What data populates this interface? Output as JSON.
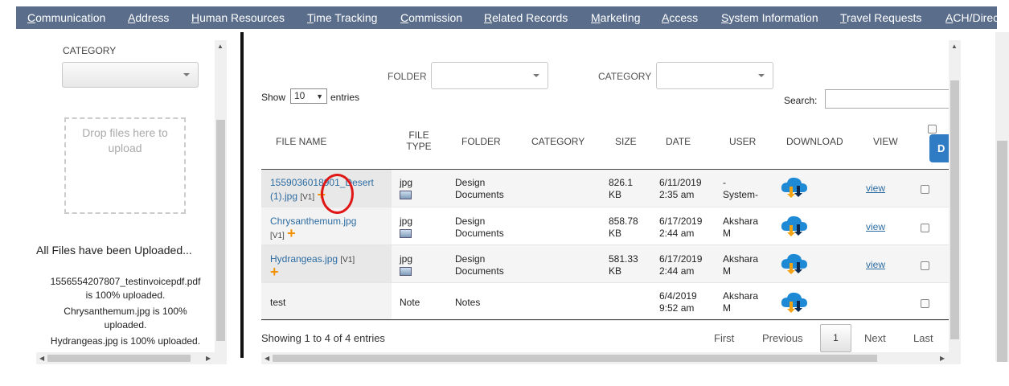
{
  "nav": {
    "tabs": [
      "Communication",
      "Address",
      "Human Resources",
      "Time Tracking",
      "Commission",
      "Related Records",
      "Marketing",
      "Access",
      "System Information",
      "Travel Requests",
      "ACH/Direc"
    ]
  },
  "left_panel": {
    "category_label": "CATEGORY",
    "category_value": "",
    "dropzone_text": "Drop files here to upload",
    "uploaded_title": "All Files have been Uploaded...",
    "uploads": [
      {
        "line1": "1556554207807_testinvoicepdf.pdf",
        "line2": "is 100% uploaded."
      },
      {
        "line1": "Chrysanthemum.jpg is 100%",
        "line2": "uploaded."
      },
      {
        "line1": "Hydrangeas.jpg is 100% uploaded.",
        "line2": ""
      }
    ]
  },
  "main": {
    "folder_label": "FOLDER",
    "folder_value": "",
    "category_label": "CATEGORY",
    "category_value": "",
    "show_label": "Show",
    "show_value": "10",
    "entries_label": "entries",
    "search_label": "Search:",
    "search_value": "",
    "headers": {
      "file_name": "FILE NAME",
      "file_type_1": "FILE",
      "file_type_2": "TYPE",
      "folder": "FOLDER",
      "category": "CATEGORY",
      "size": "SIZE",
      "date": "DATE",
      "user": "USER",
      "download": "DOWNLOAD",
      "view": "VIEW",
      "bulk_button": "D"
    },
    "rows": [
      {
        "name_1": "1559036018901_Desert",
        "name_2": "(1).jpg",
        "version": "[V1]",
        "type": "jpg",
        "folder_1": "Design",
        "folder_2": "Documents",
        "size_1": "826.1",
        "size_2": "KB",
        "date_1": "6/11/2019",
        "date_2": "2:35 am",
        "user_1": "-",
        "user_2": "System-",
        "view": "view"
      },
      {
        "name_1": "Chrysanthemum.jpg",
        "name_2": "",
        "version": "[V1]",
        "type": "jpg",
        "folder_1": "Design",
        "folder_2": "Documents",
        "size_1": "858.78",
        "size_2": "KB",
        "date_1": "6/17/2019",
        "date_2": "2:44 am",
        "user_1": "Akshara",
        "user_2": "M",
        "view": "view"
      },
      {
        "name_1": "Hydrangeas.jpg",
        "name_2": "",
        "version": "[V1]",
        "type": "jpg",
        "folder_1": "Design",
        "folder_2": "Documents",
        "size_1": "581.33",
        "size_2": "KB",
        "date_1": "6/17/2019",
        "date_2": "2:44 am",
        "user_1": "Akshara",
        "user_2": "M",
        "view": "view"
      },
      {
        "name_1": "test",
        "name_2": "",
        "version": "",
        "type": "Note",
        "folder_1": "Notes",
        "folder_2": "",
        "size_1": "",
        "size_2": "",
        "date_1": "6/4/2019",
        "date_2": "9:52 am",
        "user_1": "Akshara",
        "user_2": "M",
        "view": ""
      }
    ],
    "info": "Showing 1 to 4 of 4 entries",
    "pagination": {
      "first": "First",
      "previous": "Previous",
      "current": "1",
      "next": "Next",
      "last": "Last"
    }
  },
  "icons": {
    "add": "plus-icon",
    "file_type": "image-file-icon",
    "download": "cloud-download-icon"
  },
  "colors": {
    "nav_bg": "#5a6e8c",
    "link": "#2d6ca2",
    "accent_plus": "#f29100",
    "primary_button": "#2f7bc4",
    "highlight_circle": "#e01616"
  }
}
